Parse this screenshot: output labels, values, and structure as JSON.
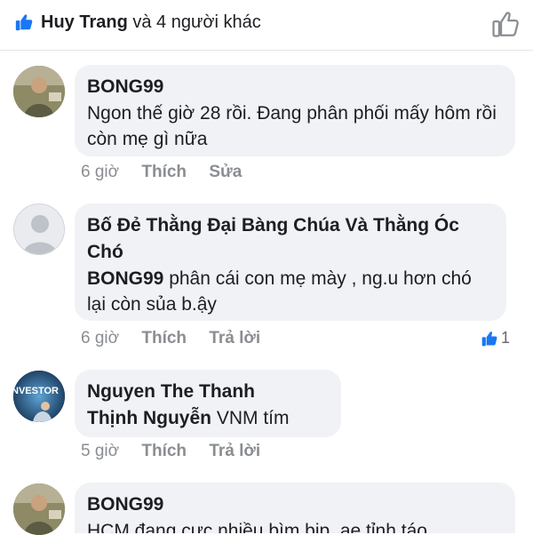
{
  "header": {
    "liker_name": "Huy Trang",
    "liker_rest": "và 4 người khác"
  },
  "comments": [
    {
      "author": "BONG99",
      "mention": "",
      "text": "Ngon thế giờ 28 rồi. Đang phân phối mấy hôm rồi còn mẹ gì nữa",
      "time": "6 giờ",
      "action1": "Thích",
      "action2": "Sửa"
    },
    {
      "author": "Bố Đẻ Thằng Đại Bàng Chúa Và Thằng Óc Chó",
      "mention": "BONG99",
      "text": "phân cái con mẹ mày , ng.u hơn chó lại còn sủa b.ậy",
      "time": "6 giờ",
      "action1": "Thích",
      "action2": "Trả lời",
      "reaction_count": "1"
    },
    {
      "author": "Nguyen The Thanh",
      "mention": "Thịnh Nguyễn",
      "text": "VNM tím",
      "time": "5 giờ",
      "action1": "Thích",
      "action2": "Trả lời",
      "avatar_text": "NVESTOR"
    },
    {
      "author": "BONG99",
      "mention": "",
      "text": "HCM đang cực nhiều bìm bịp, ae tỉnh táo"
    }
  ],
  "colors": {
    "facebook_blue": "#1877f2",
    "bubble_bg": "#f0f2f5",
    "meta_text": "#8a8d91"
  }
}
